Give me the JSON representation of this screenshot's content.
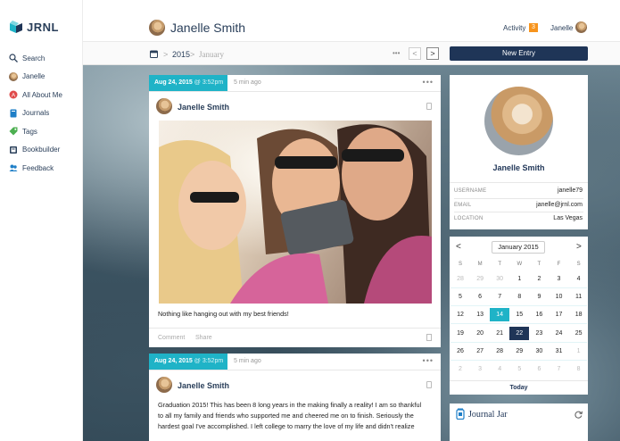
{
  "app": {
    "logo_text": "JRNL"
  },
  "sidebar": {
    "items": [
      {
        "label": "Search",
        "icon": "search-icon"
      },
      {
        "label": "Janelle",
        "icon": "avatar-icon"
      },
      {
        "label": "All About Me",
        "icon": "about-me-icon"
      },
      {
        "label": "Journals",
        "icon": "journal-icon"
      },
      {
        "label": "Tags",
        "icon": "tag-icon"
      },
      {
        "label": "Bookbuilder",
        "icon": "book-icon"
      },
      {
        "label": "Feedback",
        "icon": "feedback-icon"
      }
    ]
  },
  "header": {
    "title": "Janelle Smith",
    "activity_label": "Activity",
    "activity_count": "3",
    "user_name": "Janelle"
  },
  "subbar": {
    "year": "2015",
    "month": "January",
    "separator": ">",
    "more": "•••",
    "prev": "<",
    "next": ">",
    "new_entry": "New Entry"
  },
  "entries": [
    {
      "date": "Aug 24, 2015",
      "time": "@ 3:52pm",
      "ago": "5 min ago",
      "author": "Janelle Smith",
      "text": "Nothing like hanging out with my best friends!",
      "comment": "Comment",
      "share": "Share"
    },
    {
      "date": "Aug 24, 2015",
      "time": "@ 3:52pm",
      "ago": "5 min ago",
      "author": "Janelle Smith",
      "text_lines": [
        "Graduation 2015! This has been 8 long years in the making finally a reality! I am so thankful",
        "to all my family and friends who supported me and cheered me on to finish. Seriously the",
        "hardest goal I've accomplished. I left college to marry the love of my life and didn't realize"
      ]
    }
  ],
  "profile": {
    "name": "Janelle Smith",
    "fields": [
      {
        "label": "USERNAME",
        "value": "janelle79"
      },
      {
        "label": "EMAIL",
        "value": "janelle@jrnl.com"
      },
      {
        "label": "LOCATION",
        "value": "Las Vegas"
      }
    ]
  },
  "calendar": {
    "month_label": "January 2015",
    "prev": "<",
    "next": ">",
    "dow": [
      "S",
      "M",
      "T",
      "W",
      "T",
      "F",
      "S"
    ],
    "weeks": [
      [
        "28",
        "29",
        "30",
        "1",
        "2",
        "3",
        "4"
      ],
      [
        "5",
        "6",
        "7",
        "8",
        "9",
        "10",
        "11"
      ],
      [
        "12",
        "13",
        "14",
        "15",
        "16",
        "17",
        "18"
      ],
      [
        "19",
        "20",
        "21",
        "22",
        "23",
        "24",
        "25"
      ],
      [
        "26",
        "27",
        "28",
        "29",
        "30",
        "31",
        "1"
      ],
      [
        "2",
        "3",
        "4",
        "5",
        "6",
        "7",
        "8"
      ]
    ],
    "today_label": "Today",
    "selected_day": "14",
    "today_day": "22",
    "accent": "#1fb3c7",
    "dark": "#1f3557"
  },
  "journal_jar": {
    "title": "Journal Jar"
  },
  "colors": {
    "brand": "#1f3557",
    "accent": "#1fb3c7",
    "badge": "#f7941d"
  }
}
